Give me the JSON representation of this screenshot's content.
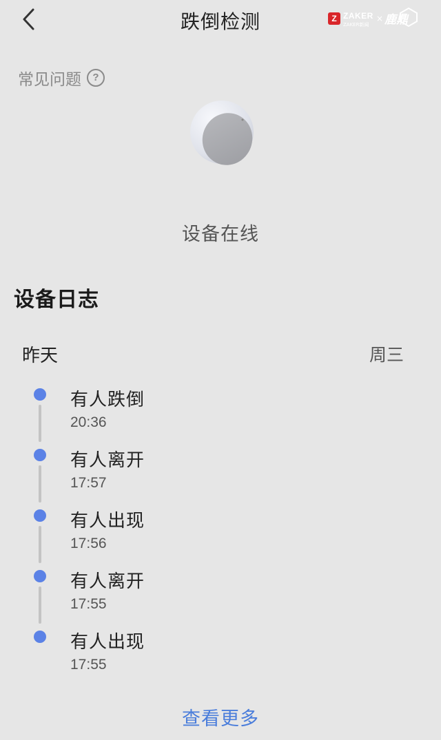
{
  "header": {
    "title": "跌倒检测",
    "back_icon": "chevron-left-icon"
  },
  "watermark": {
    "logo_letter": "Z",
    "brand": "ZAKER",
    "sub": "ZAKER新闻",
    "x": "×",
    "partner": "鹿鼎"
  },
  "faq": {
    "label": "常见问题",
    "icon": "?"
  },
  "device": {
    "image_icon": "sensor-device-icon",
    "status": "设备在线"
  },
  "log": {
    "section_title": "设备日志",
    "day": "昨天",
    "weekday": "周三",
    "accent_color": "#5b82e6",
    "events": [
      {
        "label": "有人跌倒",
        "time": "20:36"
      },
      {
        "label": "有人离开",
        "time": "17:57"
      },
      {
        "label": "有人出现",
        "time": "17:56"
      },
      {
        "label": "有人离开",
        "time": "17:55"
      },
      {
        "label": "有人出现",
        "time": "17:55"
      }
    ]
  },
  "footer": {
    "view_more": "查看更多"
  }
}
